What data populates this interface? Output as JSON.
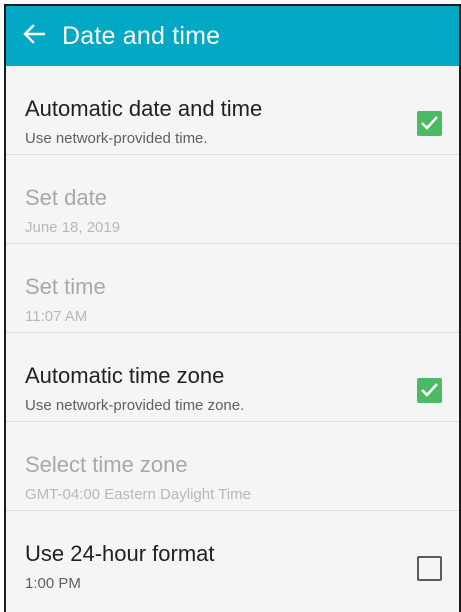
{
  "header": {
    "title": "Date and time",
    "back_icon": "arrow-back-icon"
  },
  "colors": {
    "appbar": "#03a8c4",
    "checkbox_checked": "#4cb963"
  },
  "settings": [
    {
      "title": "Automatic date and time",
      "subtitle": "Use network-provided time.",
      "enabled": true,
      "checked": true
    },
    {
      "title": "Set date",
      "subtitle": "June 18, 2019",
      "enabled": false
    },
    {
      "title": "Set time",
      "subtitle": "11:07 AM",
      "enabled": false
    },
    {
      "title": "Automatic time zone",
      "subtitle": "Use network-provided time zone.",
      "enabled": true,
      "checked": true
    },
    {
      "title": "Select time zone",
      "subtitle": "GMT-04:00 Eastern Daylight Time",
      "enabled": false
    },
    {
      "title": "Use 24-hour format",
      "subtitle": "1:00 PM",
      "enabled": true,
      "checked": false
    }
  ]
}
